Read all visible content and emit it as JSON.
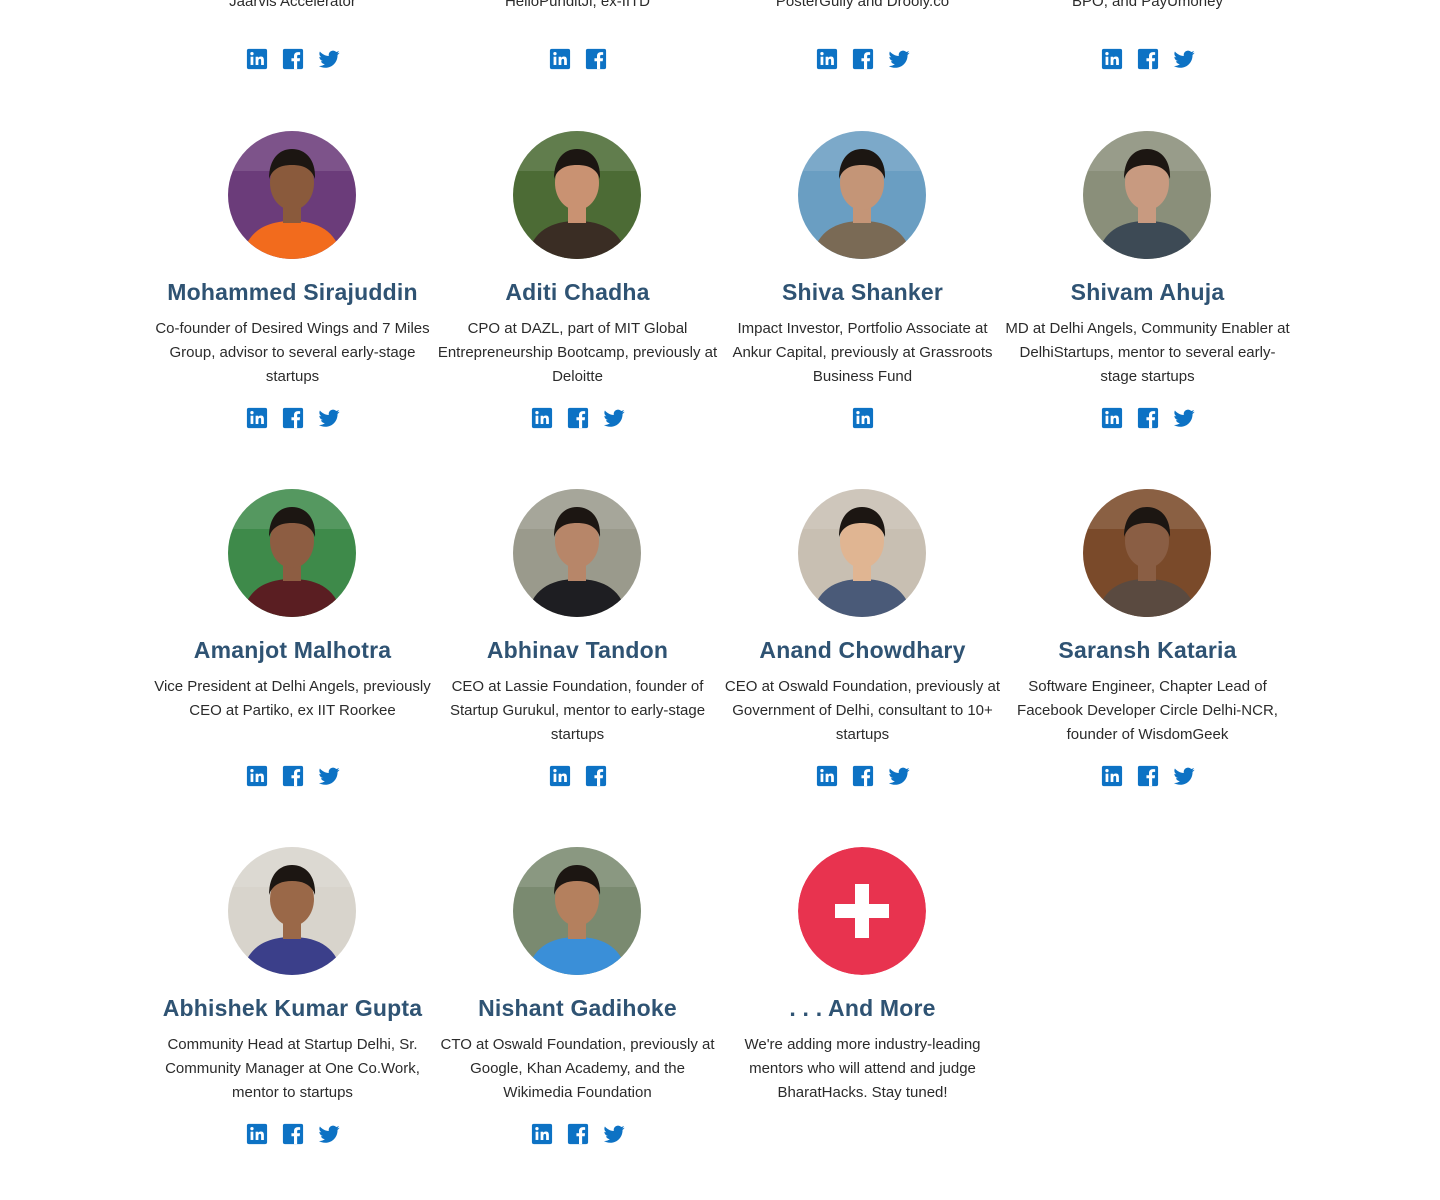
{
  "colors": {
    "name": "#2f5373",
    "social": "#0d72c4",
    "more_circle": "#e8334f"
  },
  "top_row": [
    {
      "desc": "Jaarvis Accelerator",
      "socials": [
        "linkedin-icon",
        "facebook-icon",
        "twitter-icon"
      ]
    },
    {
      "desc": "HelloPunditJi, ex-IITD",
      "socials": [
        "linkedin-icon",
        "facebook-icon"
      ]
    },
    {
      "desc": "PosterGully and Drooly.co",
      "socials": [
        "linkedin-icon",
        "facebook-icon",
        "twitter-icon"
      ]
    },
    {
      "desc": "BPO, and PayUmoney",
      "socials": [
        "linkedin-icon",
        "facebook-icon",
        "twitter-icon"
      ]
    }
  ],
  "mentors": [
    {
      "name": "Mohammed Sirajuddin",
      "desc": "Co-founder of Desired Wings and 7 Miles Group, advisor to several early-stage startups",
      "socials": [
        "linkedin-icon",
        "facebook-icon",
        "twitter-icon"
      ],
      "bg": "#6b3c7a",
      "shirt": "#f26b1d",
      "skin": "#8a5a3c"
    },
    {
      "name": "Aditi Chadha",
      "desc": "CPO at DAZL, part of MIT Global Entrepreneurship Bootcamp, previously at Deloitte",
      "socials": [
        "linkedin-icon",
        "facebook-icon",
        "twitter-icon"
      ],
      "bg": "#4c6b35",
      "shirt": "#3a2d24",
      "skin": "#c99272"
    },
    {
      "name": "Shiva Shanker",
      "desc": "Impact Investor, Portfolio Associate at Ankur Capital, previously at Grassroots Business Fund",
      "socials": [
        "linkedin-icon"
      ],
      "bg": "#6a9ec2",
      "shirt": "#7a6a55",
      "skin": "#c49577"
    },
    {
      "name": "Shivam Ahuja",
      "desc": "MD at Delhi Angels, Community Enabler at DelhiStartups, mentor to several early-stage startups",
      "socials": [
        "linkedin-icon",
        "facebook-icon",
        "twitter-icon"
      ],
      "bg": "#8a8f7a",
      "shirt": "#3d4a55",
      "skin": "#c89a80"
    },
    {
      "name": "Amanjot Malhotra",
      "desc": "Vice President at Delhi Angels, previously CEO at Partiko, ex IIT Roorkee",
      "socials": [
        "linkedin-icon",
        "facebook-icon",
        "twitter-icon"
      ],
      "bg": "#3e8a4a",
      "shirt": "#5a1e22",
      "skin": "#8d5d42"
    },
    {
      "name": "Abhinav Tandon",
      "desc": "CEO at Lassie Foundation, founder of Startup Gurukul, mentor to early-stage startups",
      "socials": [
        "linkedin-icon",
        "facebook-icon"
      ],
      "bg": "#9a9a8c",
      "shirt": "#1e1e22",
      "skin": "#b78669"
    },
    {
      "name": "Anand Chowdhary",
      "desc": "CEO at Oswald Foundation, previously at Government of Delhi, consultant to 10+ startups",
      "socials": [
        "linkedin-icon",
        "facebook-icon",
        "twitter-icon"
      ],
      "bg": "#c8bfb2",
      "shirt": "#4a5a78",
      "skin": "#e0b592"
    },
    {
      "name": "Saransh Kataria",
      "desc": "Software Engineer, Chapter Lead of Facebook Developer Circle Delhi-NCR, founder of WisdomGeek",
      "socials": [
        "linkedin-icon",
        "facebook-icon",
        "twitter-icon"
      ],
      "bg": "#7a4a2a",
      "shirt": "#5a4a40",
      "skin": "#8a5e44"
    },
    {
      "name": "Abhishek Kumar Gupta",
      "desc": "Community Head at Startup Delhi, Sr. Community Manager at One Co.Work, mentor to startups",
      "socials": [
        "linkedin-icon",
        "facebook-icon",
        "twitter-icon"
      ],
      "bg": "#d8d4cc",
      "shirt": "#3b3f8a",
      "skin": "#9a6848"
    },
    {
      "name": "Nishant Gadihoke",
      "desc": "CTO at Oswald Foundation, previously at Google, Khan Academy, and the Wikimedia Foundation",
      "socials": [
        "linkedin-icon",
        "facebook-icon",
        "twitter-icon"
      ],
      "bg": "#7a8a70",
      "shirt": "#3a8fd8",
      "skin": "#b4805e"
    }
  ],
  "more": {
    "name": ". . . And More",
    "desc": "We're adding more industry-leading mentors who will attend and judge BharatHacks. Stay tuned!",
    "icon": "plus-icon"
  }
}
